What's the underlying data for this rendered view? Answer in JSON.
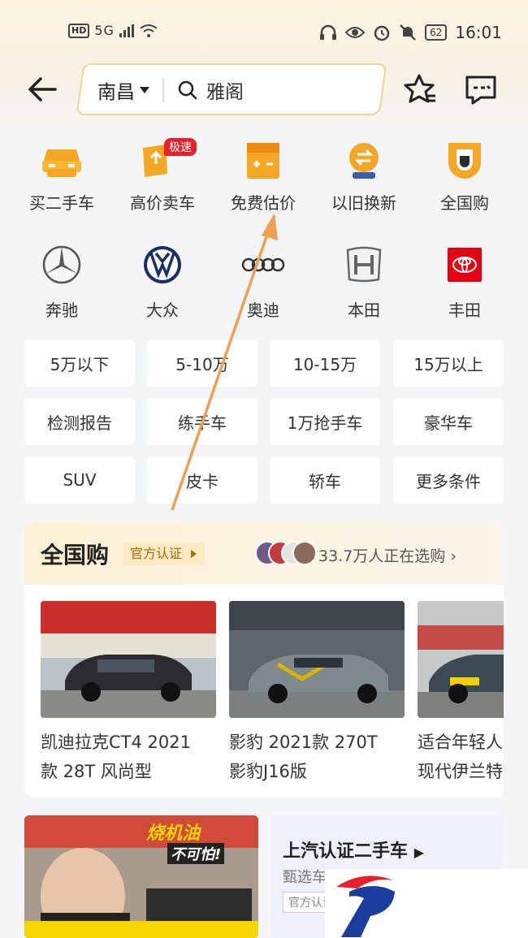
{
  "status_bar": {
    "hd": "HD",
    "network": "5G",
    "battery": "62",
    "time": "16:01"
  },
  "header": {
    "city": "南昌",
    "query": "雅阁"
  },
  "quick_menu": [
    {
      "label": "买二手车",
      "icon": "car-icon"
    },
    {
      "label": "高价卖车",
      "icon": "sell-car-icon",
      "badge": "极速"
    },
    {
      "label": "免费估价",
      "icon": "calculator-icon"
    },
    {
      "label": "以旧换新",
      "icon": "exchange-icon"
    },
    {
      "label": "全国购",
      "icon": "shield-icon"
    }
  ],
  "brands": [
    {
      "label": "奔驰",
      "icon": "mercedes-logo"
    },
    {
      "label": "大众",
      "icon": "volkswagen-logo"
    },
    {
      "label": "奥迪",
      "icon": "audi-logo"
    },
    {
      "label": "本田",
      "icon": "honda-logo"
    },
    {
      "label": "丰田",
      "icon": "toyota-logo"
    }
  ],
  "filters": [
    [
      "5万以下",
      "5-10万",
      "10-15万",
      "15万以上"
    ],
    [
      "检测报告",
      "练手车",
      "1万抢手车",
      "豪华车"
    ],
    [
      "SUV",
      "皮卡",
      "轿车",
      "更多条件"
    ]
  ],
  "nationwide": {
    "title": "全国购",
    "cert_label": "官方认证",
    "buying_text": "33.7万人正在选购",
    "cars": [
      {
        "title": "凯迪拉克CT4 2021\n款 28T 风尚型"
      },
      {
        "title": "影豹 2021款 270T\n影豹J16版"
      },
      {
        "title": "适合年轻人\n现代伊兰特"
      }
    ]
  },
  "video": {
    "tag1": "烧机油",
    "tag2": "不可怕!"
  },
  "promo": {
    "title": "上汽认证二手车",
    "subtitle": "甄选车源 厂家认证",
    "tag": "官方认证"
  },
  "colors": {
    "accent": "#f5a623",
    "badge": "#e7202c",
    "toyota": "#e50012",
    "annotation_arrow": "#f0a050"
  }
}
